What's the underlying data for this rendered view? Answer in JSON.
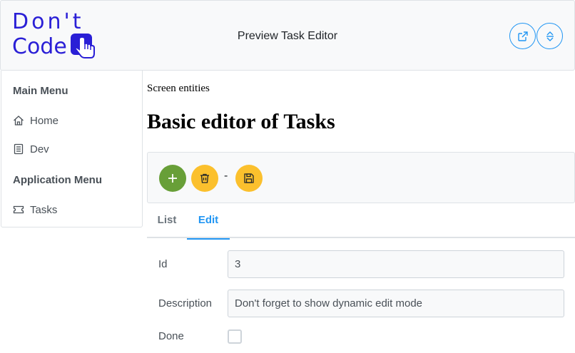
{
  "header": {
    "logo_line1": "Don't",
    "logo_line2": "Code",
    "title": "Preview Task Editor",
    "actions": [
      {
        "name": "open-external-icon"
      },
      {
        "name": "sort-icon"
      }
    ]
  },
  "sidebar": {
    "main_menu_label": "Main Menu",
    "main_items": [
      {
        "label": "Home",
        "icon": "home-icon"
      },
      {
        "label": "Dev",
        "icon": "document-icon"
      }
    ],
    "app_menu_label": "Application Menu",
    "app_items": [
      {
        "label": "Tasks",
        "icon": "ticket-icon"
      }
    ]
  },
  "main": {
    "breadcrumb": "Screen entities",
    "title": "Basic editor of Tasks",
    "toolbar": {
      "add_icon": "plus-icon",
      "delete_icon": "trash-icon",
      "separator": "-",
      "save_icon": "save-icon"
    },
    "tabs": [
      {
        "label": "List",
        "active": false
      },
      {
        "label": "Edit",
        "active": true
      }
    ],
    "form": {
      "id_label": "Id",
      "id_value": "3",
      "description_label": "Description",
      "description_value": "Don't forget to show dynamic edit mode",
      "done_label": "Done",
      "done_checked": false
    }
  },
  "colors": {
    "brand": "#2a1fd6",
    "primary": "#2196f3",
    "success": "#689f38",
    "warning": "#fbc02d"
  }
}
